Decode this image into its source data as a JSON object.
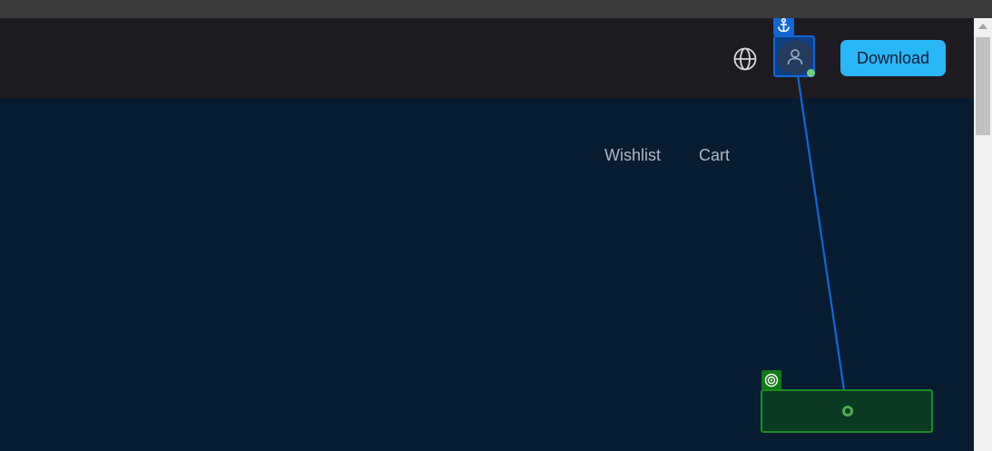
{
  "header": {
    "language_icon": "globe-icon",
    "avatar_icon": "user-icon",
    "download_label": "Download",
    "colors": {
      "header_bg": "#1d1b20",
      "page_bg": "#081c31",
      "accent": "#29b6f6",
      "online_status": "#6fcf7b"
    }
  },
  "nav": {
    "wishlist_label": "Wishlist",
    "cart_label": "Cart"
  },
  "overlay": {
    "anchor_icon": "anchor-icon",
    "target_icon": "target-icon",
    "anchor_color": "#1366d6",
    "target_color": "#1c8a22"
  }
}
